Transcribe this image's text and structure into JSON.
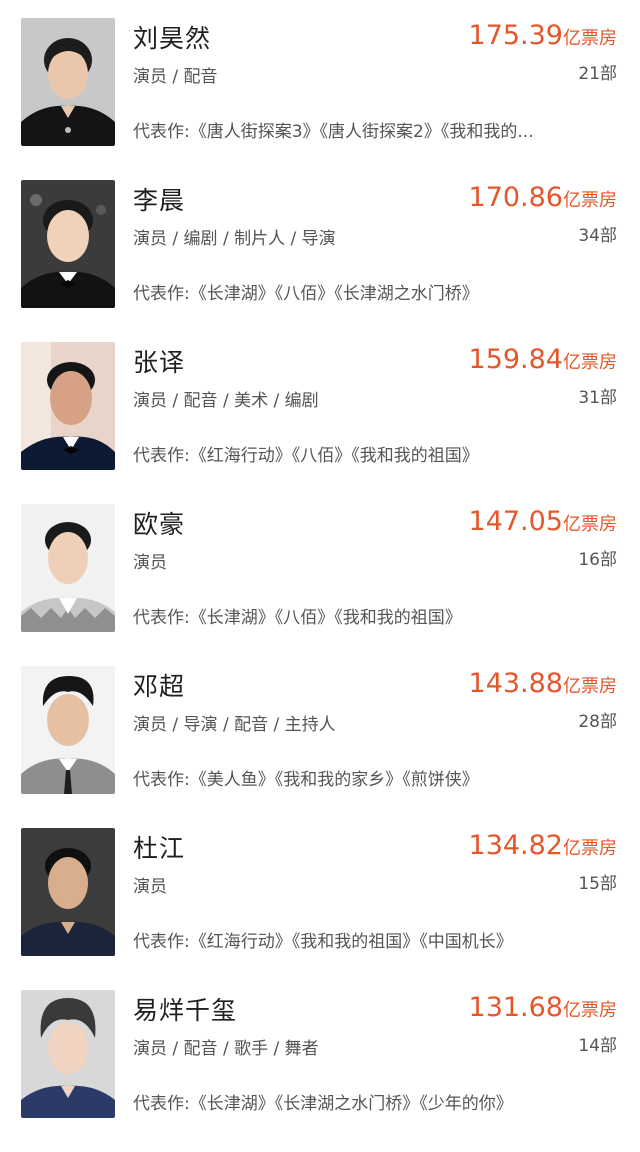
{
  "celebrities": [
    {
      "name": "刘昊然",
      "roles": "演员 / 配音",
      "box_value": "175.39",
      "box_unit": "亿票房",
      "film_count": "21部",
      "works": "代表作:《唐人街探案3》《唐人街探案2》《我和我的..."
    },
    {
      "name": "李晨",
      "roles": "演员 / 编剧 / 制片人 / 导演",
      "box_value": "170.86",
      "box_unit": "亿票房",
      "film_count": "34部",
      "works": "代表作:《长津湖》《八佰》《长津湖之水门桥》"
    },
    {
      "name": "张译",
      "roles": "演员 / 配音 / 美术 / 编剧",
      "box_value": "159.84",
      "box_unit": "亿票房",
      "film_count": "31部",
      "works": "代表作:《红海行动》《八佰》《我和我的祖国》"
    },
    {
      "name": "欧豪",
      "roles": "演员",
      "box_value": "147.05",
      "box_unit": "亿票房",
      "film_count": "16部",
      "works": "代表作:《长津湖》《八佰》《我和我的祖国》"
    },
    {
      "name": "邓超",
      "roles": "演员 / 导演 / 配音 / 主持人",
      "box_value": "143.88",
      "box_unit": "亿票房",
      "film_count": "28部",
      "works": "代表作:《美人鱼》《我和我的家乡》《煎饼侠》"
    },
    {
      "name": "杜江",
      "roles": "演员",
      "box_value": "134.82",
      "box_unit": "亿票房",
      "film_count": "15部",
      "works": "代表作:《红海行动》《我和我的祖国》《中国机长》"
    },
    {
      "name": "易烊千玺",
      "roles": "演员 / 配音 / 歌手 / 舞者",
      "box_value": "131.68",
      "box_unit": "亿票房",
      "film_count": "14部",
      "works": "代表作:《长津湖》《长津湖之水门桥》《少年的你》"
    }
  ],
  "colors": {
    "accent": "#e4572a",
    "text_primary": "#1f1f1f",
    "text_secondary": "#555555"
  }
}
